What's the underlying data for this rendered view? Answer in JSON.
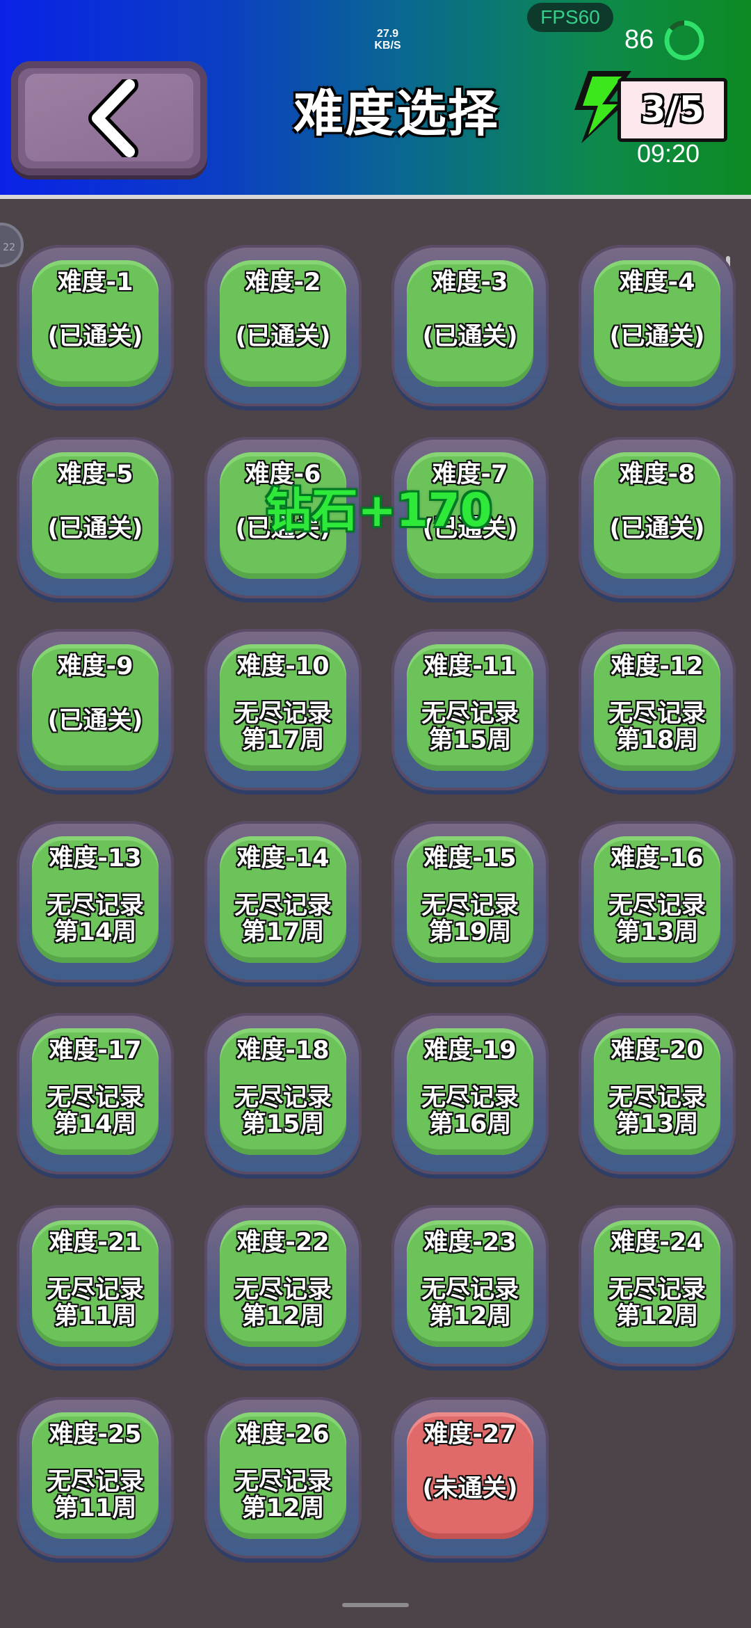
{
  "status_bar": {
    "net_speed_value": "27.9",
    "net_speed_unit": "KB/S",
    "fps": "FPS60",
    "battery": "86"
  },
  "header": {
    "title": "难度选择",
    "energy_count": "3/5",
    "timer": "09:20"
  },
  "side_tab": {
    "label": "22"
  },
  "reward_popup": "钻石+170",
  "levels": [
    {
      "name": "难度-1",
      "status": "(已通关)"
    },
    {
      "name": "难度-2",
      "status": "(已通关)"
    },
    {
      "name": "难度-3",
      "status": "(已通关)"
    },
    {
      "name": "难度-4",
      "status": "(已通关)"
    },
    {
      "name": "难度-5",
      "status": "(已通关)"
    },
    {
      "name": "难度-6",
      "status": "(已通关)"
    },
    {
      "name": "难度-7",
      "status": "(已通关)"
    },
    {
      "name": "难度-8",
      "status": "(已通关)"
    },
    {
      "name": "难度-9",
      "status": "(已通关)"
    },
    {
      "name": "难度-10",
      "record": "无尽记录",
      "weeks": "第17周"
    },
    {
      "name": "难度-11",
      "record": "无尽记录",
      "weeks": "第15周"
    },
    {
      "name": "难度-12",
      "record": "无尽记录",
      "weeks": "第18周"
    },
    {
      "name": "难度-13",
      "record": "无尽记录",
      "weeks": "第14周"
    },
    {
      "name": "难度-14",
      "record": "无尽记录",
      "weeks": "第17周"
    },
    {
      "name": "难度-15",
      "record": "无尽记录",
      "weeks": "第19周"
    },
    {
      "name": "难度-16",
      "record": "无尽记录",
      "weeks": "第13周"
    },
    {
      "name": "难度-17",
      "record": "无尽记录",
      "weeks": "第14周"
    },
    {
      "name": "难度-18",
      "record": "无尽记录",
      "weeks": "第15周"
    },
    {
      "name": "难度-19",
      "record": "无尽记录",
      "weeks": "第16周"
    },
    {
      "name": "难度-20",
      "record": "无尽记录",
      "weeks": "第13周"
    },
    {
      "name": "难度-21",
      "record": "无尽记录",
      "weeks": "第11周"
    },
    {
      "name": "难度-22",
      "record": "无尽记录",
      "weeks": "第12周"
    },
    {
      "name": "难度-23",
      "record": "无尽记录",
      "weeks": "第12周"
    },
    {
      "name": "难度-24",
      "record": "无尽记录",
      "weeks": "第12周"
    },
    {
      "name": "难度-25",
      "record": "无尽记录",
      "weeks": "第11周"
    },
    {
      "name": "难度-26",
      "record": "无尽记录",
      "weeks": "第12周"
    },
    {
      "name": "难度-27",
      "status": "(未通关)",
      "locked": true
    }
  ],
  "colors": {
    "cleared": "#6cc35a",
    "uncleared": "#e06a6a",
    "background": "#4c4448"
  }
}
